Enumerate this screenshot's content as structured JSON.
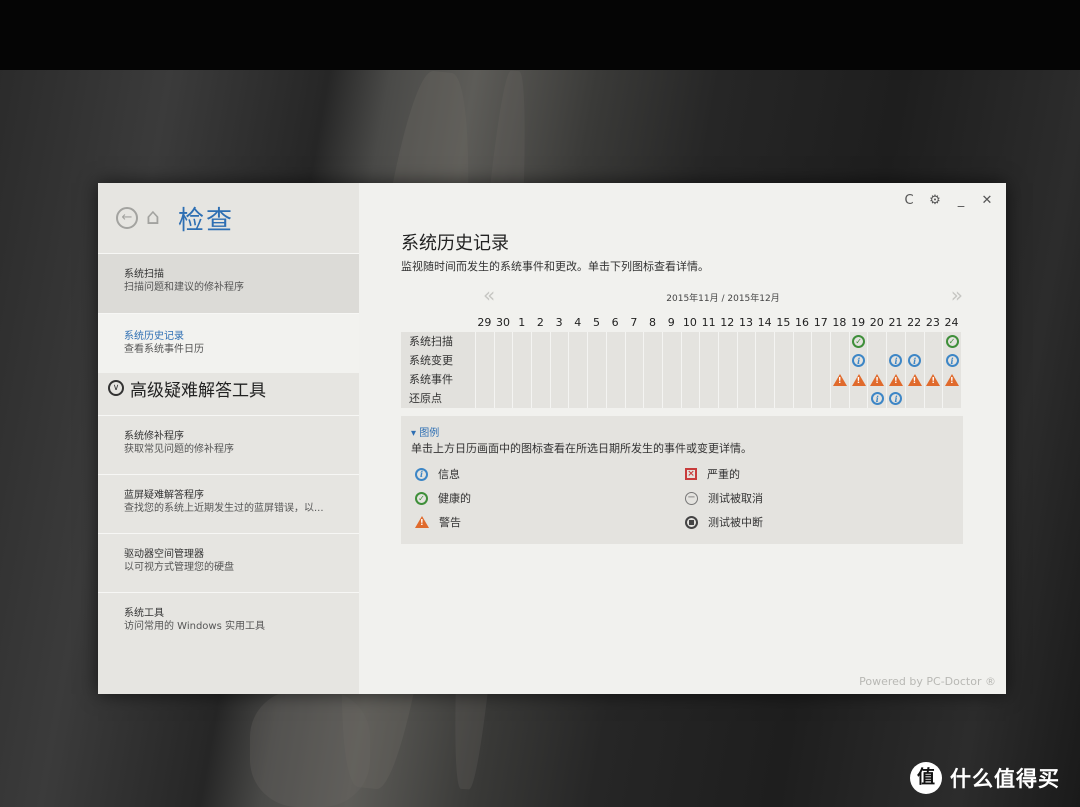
{
  "app": {
    "title": "检查",
    "back_icon": "back-arrow-icon",
    "home_icon": "home-icon"
  },
  "sidebar": {
    "items": [
      {
        "title": "系统扫描",
        "desc": "扫描问题和建议的修补程序"
      },
      {
        "title": "系统历史记录",
        "desc": "查看系统事件日历"
      }
    ],
    "section": {
      "label": "高级疑难解答工具"
    },
    "tools": [
      {
        "title": "系统修补程序",
        "desc": "获取常见问题的修补程序"
      },
      {
        "title": "蓝屏疑难解答程序",
        "desc": "查找您的系统上近期发生过的蓝屏错误，以..."
      },
      {
        "title": "驱动器空间管理器",
        "desc": "以可视方式管理您的硬盘"
      },
      {
        "title": "系统工具",
        "desc": "访问常用的 Windows 实用工具"
      }
    ]
  },
  "window_controls": {
    "refresh": "C",
    "settings": "⚙",
    "minimize": "_",
    "close": "✕"
  },
  "main": {
    "title": "系统历史记录",
    "subtitle": "监视随时间而发生的系统事件和更改。单击下列图标查看详情。",
    "month_label": "2015年11月 / 2015年12月",
    "prev": "«",
    "next": "»"
  },
  "calendar": {
    "days": [
      "29",
      "30",
      "1",
      "2",
      "3",
      "4",
      "5",
      "6",
      "7",
      "8",
      "9",
      "10",
      "11",
      "12",
      "13",
      "14",
      "15",
      "16",
      "17",
      "18",
      "19",
      "20",
      "21",
      "22",
      "23",
      "24"
    ],
    "rows": [
      {
        "label": "系统扫描",
        "events": {
          "19": "ok",
          "24": "ok"
        }
      },
      {
        "label": "系统变更",
        "events": {
          "19": "info",
          "21": "info",
          "22": "info",
          "24": "info"
        }
      },
      {
        "label": "系统事件",
        "events": {
          "18": "warn",
          "19": "warn",
          "20": "warn",
          "21": "warn",
          "22": "warn",
          "23": "warn",
          "24": "warn"
        }
      },
      {
        "label": "还原点",
        "events": {
          "20": "info",
          "21": "info"
        }
      }
    ]
  },
  "legend": {
    "header": "图例",
    "description": "单击上方日历画面中的图标查看在所选日期所发生的事件或变更详情。",
    "items": {
      "info": "信息",
      "ok": "健康的",
      "warn": "警告",
      "critical": "严重的",
      "cancelled": "测试被取消",
      "interrupted": "测试被中断"
    }
  },
  "footer": "Powered by PC-Doctor ®",
  "watermark": {
    "logo": "值",
    "text": "什么值得买"
  }
}
